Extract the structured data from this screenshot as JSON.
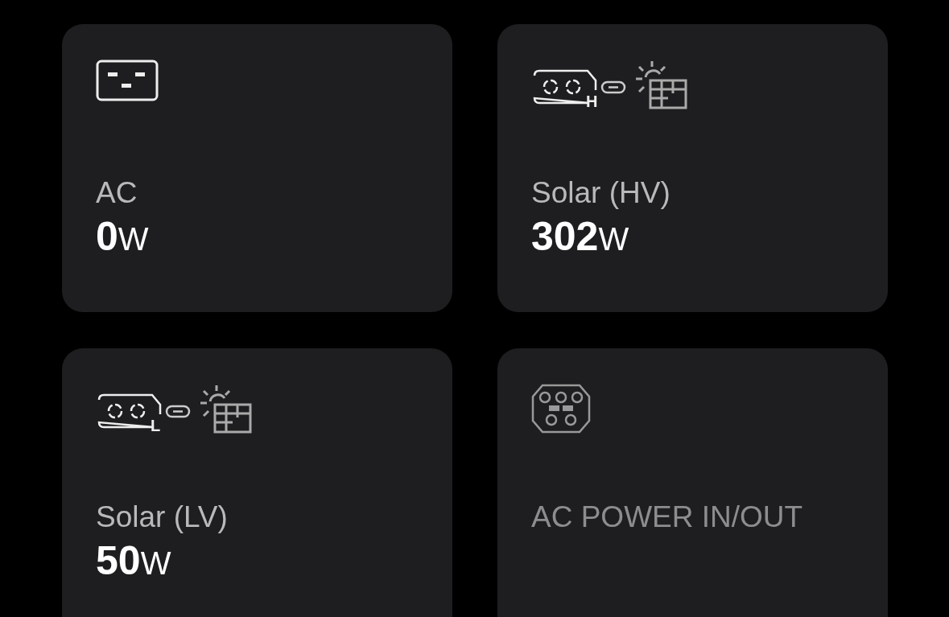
{
  "cards": [
    {
      "kind": "ac",
      "title": "AC",
      "value": "0",
      "unit": "W",
      "dimmed": false
    },
    {
      "kind": "solar",
      "letter": "H",
      "title": "Solar (HV)",
      "value": "302",
      "unit": "W",
      "dimmed": false
    },
    {
      "kind": "solar",
      "letter": "L",
      "title": "Solar (LV)",
      "value": "50",
      "unit": "W",
      "dimmed": false
    },
    {
      "kind": "port",
      "title": "AC POWER IN/OUT",
      "dimmed": true
    }
  ]
}
